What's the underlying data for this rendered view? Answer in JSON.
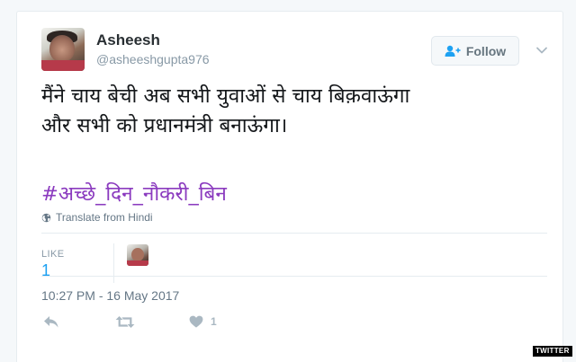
{
  "user": {
    "name": "Asheesh",
    "handle": "@asheeshgupta976"
  },
  "follow_button": {
    "label": "Follow"
  },
  "tweet": {
    "text_lines": [
      "मैंने चाय बेची अब सभी युवाओं से चाय बिक़वाऊंगा",
      "और सभी को प्रधानमंत्री बनाऊंगा।"
    ],
    "hashtag": "#अच्छे_दिन_नौकरी_बिन",
    "translate_label": "Translate from Hindi",
    "likes_label": "LIKE",
    "likes_count": "1",
    "timestamp": "10:27 PM - 16 May 2017"
  },
  "actions": {
    "like_count": "1"
  },
  "icons": {
    "reply": "reply-icon",
    "retweet": "retweet-icon",
    "like": "heart-icon",
    "globe": "globe-icon",
    "follow": "add-user-icon",
    "more": "chevron-down-icon"
  },
  "colors": {
    "follow_icon": "#1da1f2",
    "hashtag": "#8b3bbf",
    "likes_count": "#1da1f2",
    "muted": "#8899a6"
  },
  "watermark": "TWITTER"
}
